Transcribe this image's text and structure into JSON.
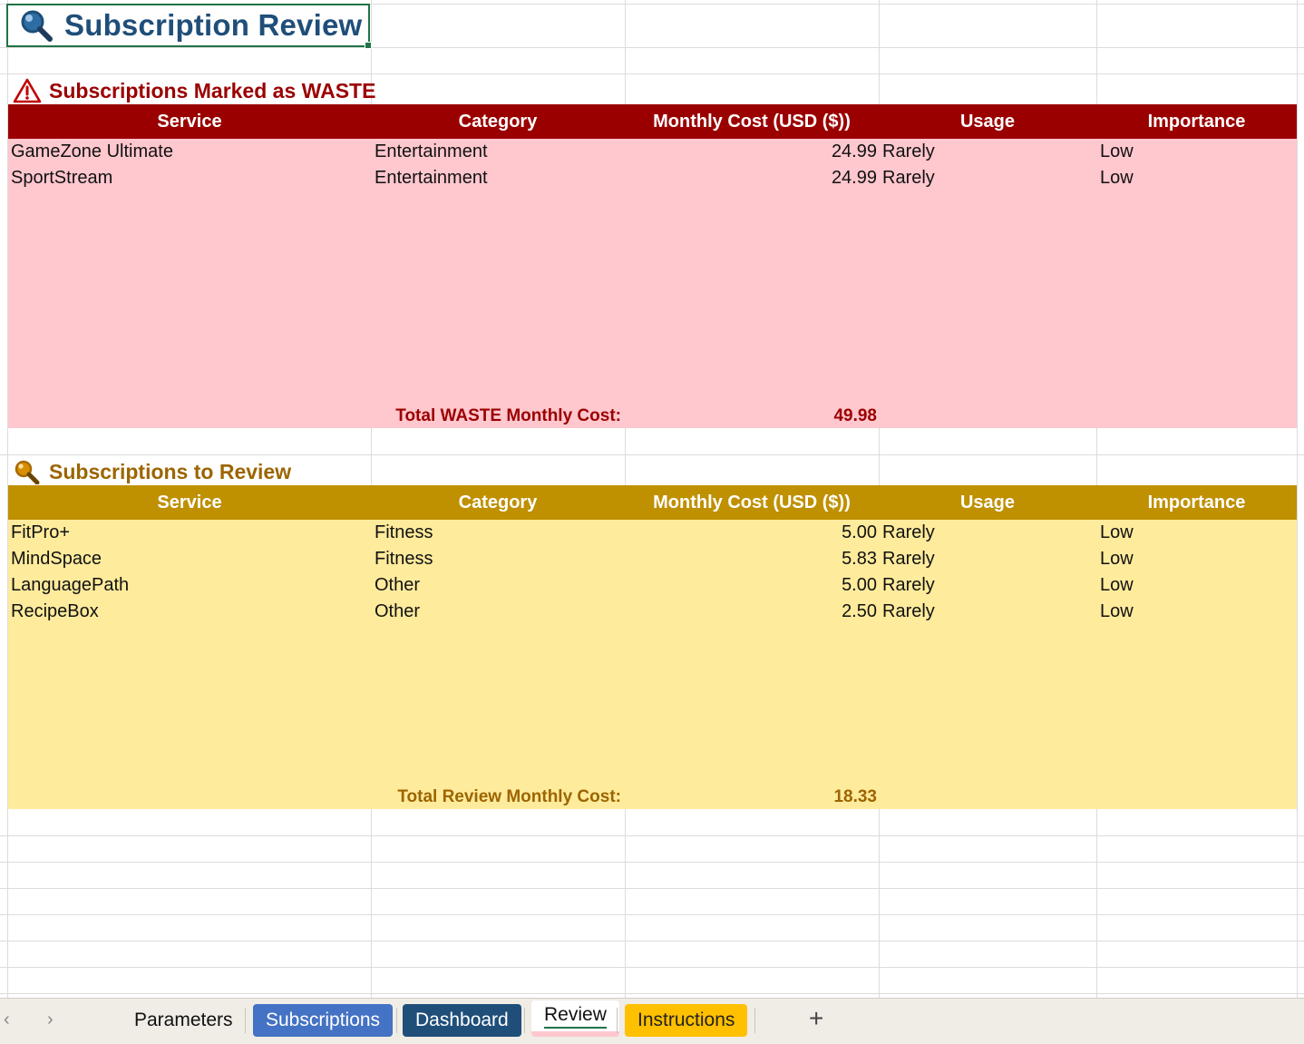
{
  "sheet": {
    "title": "Subscription Review"
  },
  "colors": {
    "waste_header": "#9b0000",
    "waste_fill": "#ffc7ce",
    "waste_text": "#9b0000",
    "review_header": "#bf9000",
    "review_fill": "#ffeb9c",
    "review_text": "#9c6500",
    "title_text": "#1f4e79"
  },
  "waste": {
    "title": "Subscriptions Marked as WASTE",
    "icon": "warning-triangle-icon",
    "columns": [
      "Service",
      "Category",
      "Monthly Cost (USD ($))",
      "Usage",
      "Importance"
    ],
    "rows": [
      {
        "service": "GameZone Ultimate",
        "category": "Entertainment",
        "cost": "24.99",
        "usage": "Rarely",
        "importance": "Low"
      },
      {
        "service": "SportStream",
        "category": "Entertainment",
        "cost": "24.99",
        "usage": "Rarely",
        "importance": "Low"
      }
    ],
    "total_label": "Total WASTE Monthly Cost:",
    "total_value": "49.98"
  },
  "review": {
    "title": "Subscriptions to Review",
    "icon": "magnifier-icon",
    "columns": [
      "Service",
      "Category",
      "Monthly Cost (USD ($))",
      "Usage",
      "Importance"
    ],
    "rows": [
      {
        "service": "FitPro+",
        "category": "Fitness",
        "cost": "5.00",
        "usage": "Rarely",
        "importance": "Low"
      },
      {
        "service": "MindSpace",
        "category": "Fitness",
        "cost": "5.83",
        "usage": "Rarely",
        "importance": "Low"
      },
      {
        "service": "LanguagePath",
        "category": "Other",
        "cost": "5.00",
        "usage": "Rarely",
        "importance": "Low"
      },
      {
        "service": "RecipeBox",
        "category": "Other",
        "cost": "2.50",
        "usage": "Rarely",
        "importance": "Low"
      }
    ],
    "total_label": "Total Review Monthly Cost:",
    "total_value": "18.33"
  },
  "tabs": {
    "items": [
      {
        "label": "Parameters",
        "bg": "transparent",
        "color": "#222222",
        "active": false
      },
      {
        "label": "Subscriptions",
        "bg": "#4472c4",
        "color": "#ffffff",
        "active": false
      },
      {
        "label": "Dashboard",
        "bg": "#1f4e79",
        "color": "#ffffff",
        "active": false
      },
      {
        "label": "Review",
        "bg": "#ffc7ce",
        "color": "#222222",
        "active": true
      },
      {
        "label": "Instructions",
        "bg": "#ffc000",
        "color": "#222222",
        "active": false
      }
    ],
    "prev_icon": "chevron-left-icon",
    "next_icon": "chevron-right-icon",
    "add_icon": "plus-icon"
  }
}
